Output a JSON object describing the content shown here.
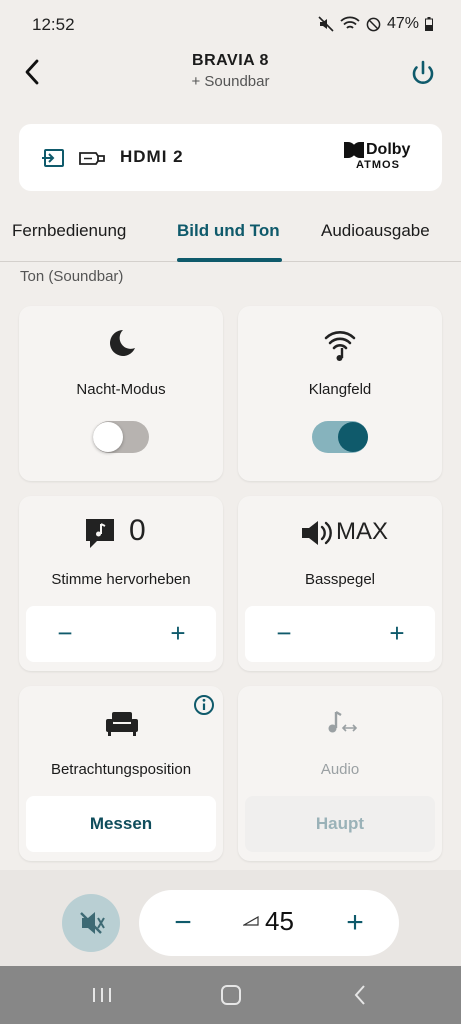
{
  "status": {
    "time": "12:52",
    "battery": "47%"
  },
  "header": {
    "title": "BRAVIA 8",
    "subtitle": "+ Soundbar"
  },
  "input": {
    "label": "HDMI 2",
    "logo_brand": "Dolby",
    "logo_sub": "ATMOS"
  },
  "tabs": [
    {
      "label": "Fernbedienung",
      "active": false
    },
    {
      "label": "Bild und Ton",
      "active": true
    },
    {
      "label": "Audioausgabe",
      "active": false
    }
  ],
  "section": {
    "label": "Ton (Soundbar)"
  },
  "cards": {
    "night": {
      "label": "Nacht-Modus",
      "on": false
    },
    "soundfield": {
      "label": "Klangfeld",
      "on": true
    },
    "voice": {
      "label": "Stimme hervorheben",
      "value": "0",
      "minus": "−",
      "plus": "+"
    },
    "bass": {
      "label": "Basspegel",
      "value": "MAX",
      "minus": "−",
      "plus": "+"
    },
    "position": {
      "label": "Betrachtungsposition",
      "button": "Messen"
    },
    "audio": {
      "label": "Audio",
      "button": "Haupt"
    }
  },
  "volume": {
    "minus": "−",
    "plus": "+",
    "value": "45"
  },
  "colors": {
    "accent": "#0f5a6b",
    "background": "#f1eeeb"
  }
}
